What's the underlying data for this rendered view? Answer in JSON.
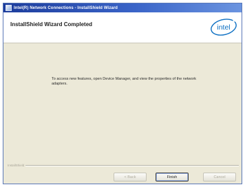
{
  "window": {
    "title": "Intel(R) Network Connections - InstallShield Wizard"
  },
  "header": {
    "title": "InstallShield Wizard Completed",
    "logo_text": "intel"
  },
  "main": {
    "message": "To access new features, open Device Manager, and view the properties of the network adapters."
  },
  "footer": {
    "brand_label": "InstallShield"
  },
  "buttons": {
    "back_label": "< Back",
    "finish_label": "Finish",
    "cancel_label": "Cancel"
  },
  "colors": {
    "intel_blue": "#0a6ec2",
    "titlebar": "#2a4fb0",
    "dialog_background": "#ece9d8"
  }
}
